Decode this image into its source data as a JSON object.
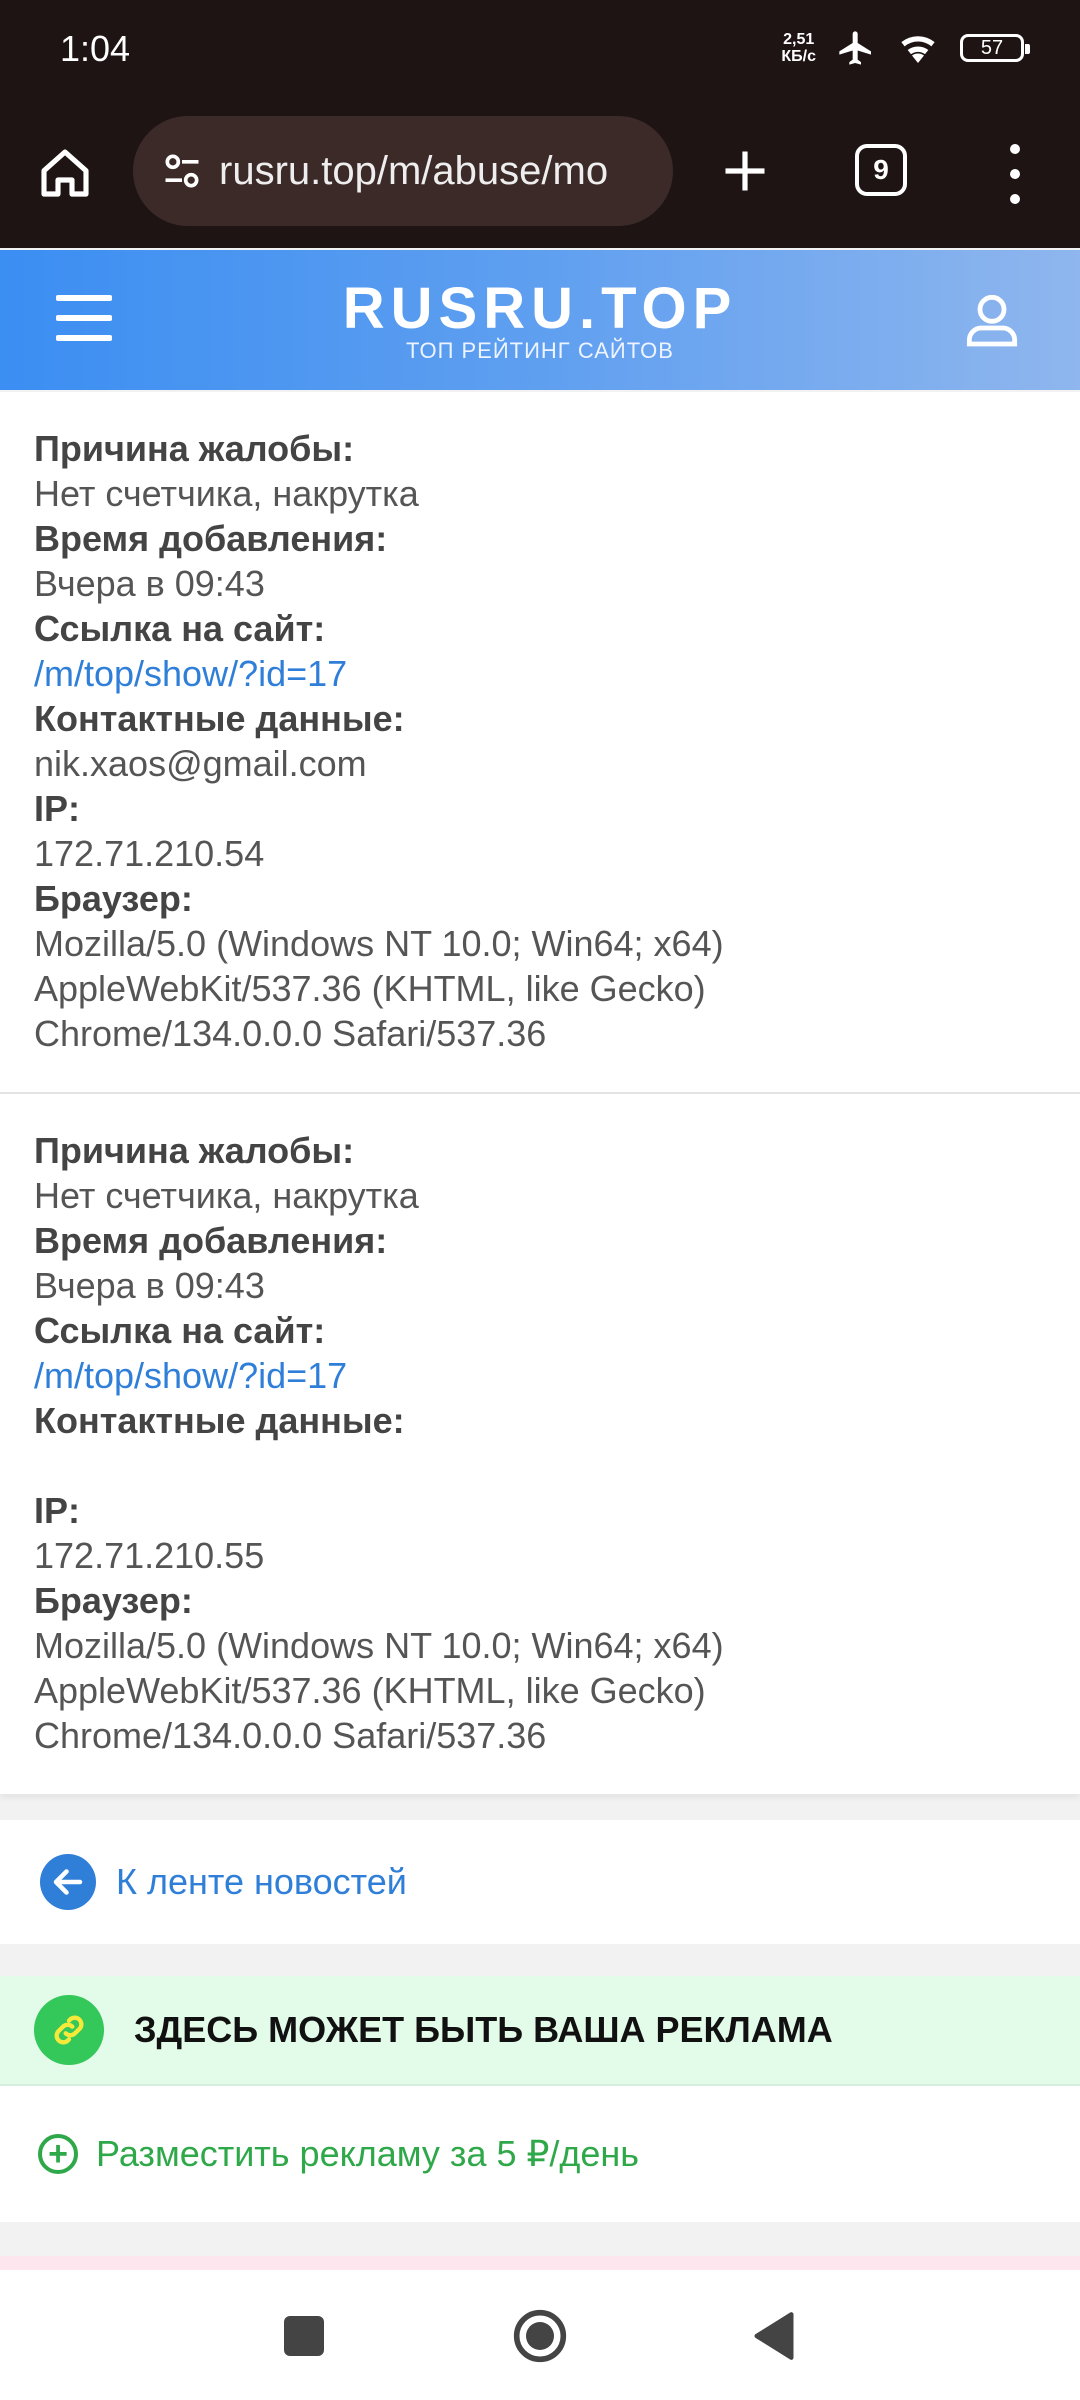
{
  "status_bar": {
    "time": "1:04",
    "net_speed_value": "2,51",
    "net_speed_unit": "КБ/с",
    "battery": "57",
    "icons": [
      "airplane-icon",
      "wifi-icon",
      "battery-icon"
    ]
  },
  "browser": {
    "url": "rusru.top/m/abuse/mo",
    "tab_count": "9",
    "icons": [
      "home-icon",
      "site-settings-icon",
      "new-tab-icon",
      "more-menu-icon"
    ]
  },
  "site_header": {
    "logo": "RUSRU.TOP",
    "tagline": "ТОП РЕЙТИНГ САЙТОВ",
    "accent_color": "#3b8ef2"
  },
  "complaints": [
    {
      "reason_label": "Причина жалобы:",
      "reason": "Нет счетчика, накрутка",
      "time_label": "Время добавления:",
      "time": "Вчера в 09:43",
      "link_label": "Ссылка на сайт:",
      "link": "/m/top/show/?id=17",
      "contacts_label": "Контактные данные:",
      "contacts": "nik.xaos@gmail.com",
      "ip_label": "IP:",
      "ip": "172.71.210.54",
      "browser_label": "Браузер:",
      "browser_line1": "Mozilla/5.0 (Windows NT 10.0; Win64; x64)",
      "browser_line2": "AppleWebKit/537.36 (KHTML, like Gecko)",
      "browser_line3": "Chrome/134.0.0.0 Safari/537.36"
    },
    {
      "reason_label": "Причина жалобы:",
      "reason": "Нет счетчика, накрутка",
      "time_label": "Время добавления:",
      "time": "Вчера в 09:43",
      "link_label": "Ссылка на сайт:",
      "link": "/m/top/show/?id=17",
      "contacts_label": "Контактные данные:",
      "contacts": "",
      "ip_label": "IP:",
      "ip": "172.71.210.55",
      "browser_label": "Браузер:",
      "browser_line1": "Mozilla/5.0 (Windows NT 10.0; Win64; x64)",
      "browser_line2": "AppleWebKit/537.36 (KHTML, like Gecko)",
      "browser_line3": "Chrome/134.0.0.0 Safari/537.36"
    }
  ],
  "back_link": {
    "label": "К ленте новостей"
  },
  "ad_block": {
    "title": "ЗДЕСЬ МОЖЕТ БЫТЬ ВАША РЕКЛАМА",
    "action": "Разместить рекламу за 5 ₽/день",
    "color": "#2fa84a"
  },
  "nav_bar": {
    "icons": [
      "recents-icon",
      "home-circle-icon",
      "back-triangle-icon"
    ]
  }
}
